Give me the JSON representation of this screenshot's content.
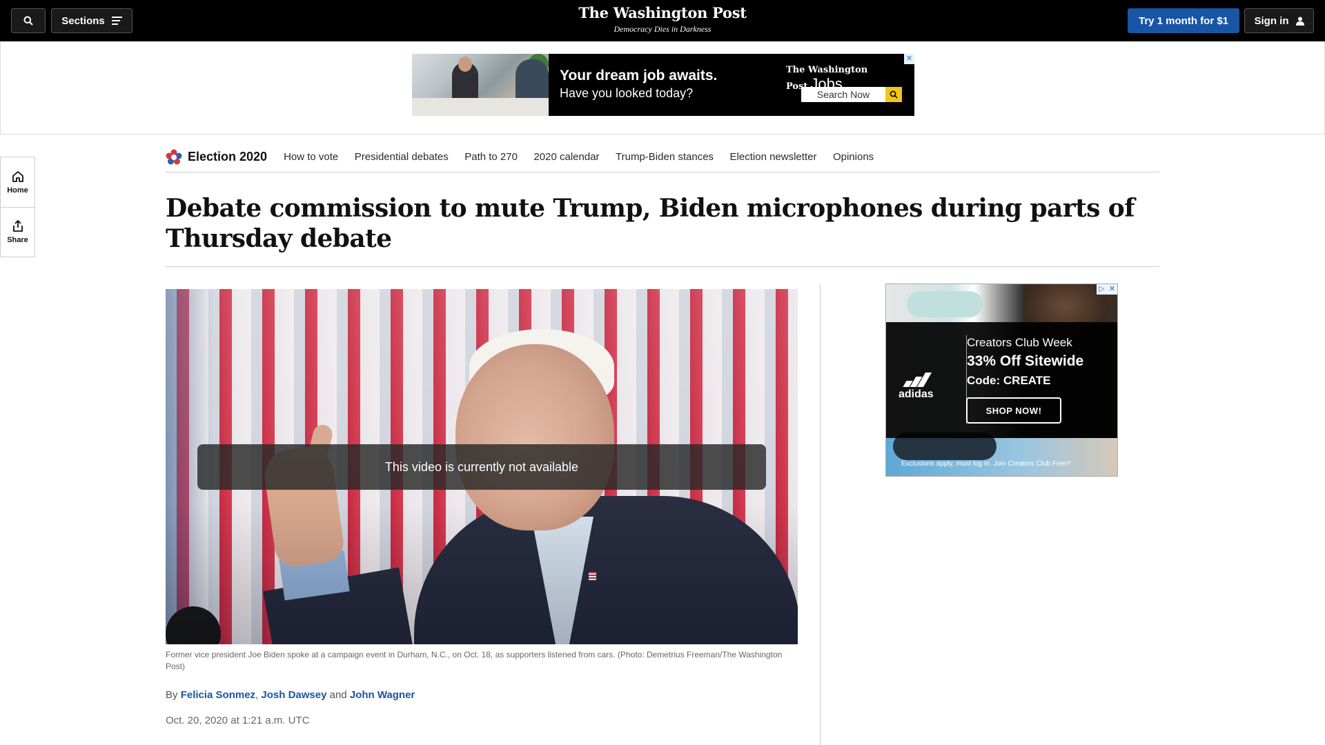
{
  "header": {
    "sections_label": "Sections",
    "logo": "The Washington Post",
    "tagline": "Democracy Dies in Darkness",
    "subscribe_label": "Try 1 month for $1",
    "signin_label": "Sign in",
    "icons": {
      "search": "search-icon",
      "sections": "hamburger-icon",
      "account": "user-icon"
    }
  },
  "top_ad": {
    "title": "Your dream job awaits.",
    "subtitle": "Have you looked today?",
    "brand": "The Washington Post",
    "brand_suffix": "Jobs",
    "search_label": "Search Now",
    "close": "✕"
  },
  "left_rail": {
    "items": [
      {
        "label": "Home",
        "icon": "home-icon"
      },
      {
        "label": "Share",
        "icon": "share-icon"
      }
    ]
  },
  "election_nav": {
    "brand": "Election 2020",
    "links": [
      "How to vote",
      "Presidential debates",
      "Path to 270",
      "2020 calendar",
      "Trump-Biden stances",
      "Election newsletter",
      "Opinions"
    ]
  },
  "article": {
    "headline": "Debate commission to mute Trump, Biden microphones during parts of Thursday debate",
    "video_message": "This video is currently not available",
    "caption": "Former vice president Joe Biden spoke at a campaign event in Durham, N.C., on Oct. 18, as supporters listened from cars. (Photo: Demetrius Freeman/The Washington Post)",
    "byline_prefix": "By",
    "authors": [
      "Felicia Sonmez",
      "Josh Dawsey",
      "John Wagner"
    ],
    "byline_sep": ",",
    "byline_and": "and",
    "date": "Oct. 20, 2020 at 1:21 a.m. UTC"
  },
  "side_ad": {
    "brand": "adidas",
    "line1": "Creators Club Week",
    "line2": "33% Off Sitewide",
    "line3": "Code: CREATE",
    "cta": "SHOP NOW!",
    "fine_print": "Exclusions apply, must log in. Join Creators Club Free!*",
    "choices_icon": "▷",
    "close": "✕"
  },
  "colors": {
    "topbar": "#000000",
    "accent": "#1955a5",
    "link": "#1955a5"
  }
}
